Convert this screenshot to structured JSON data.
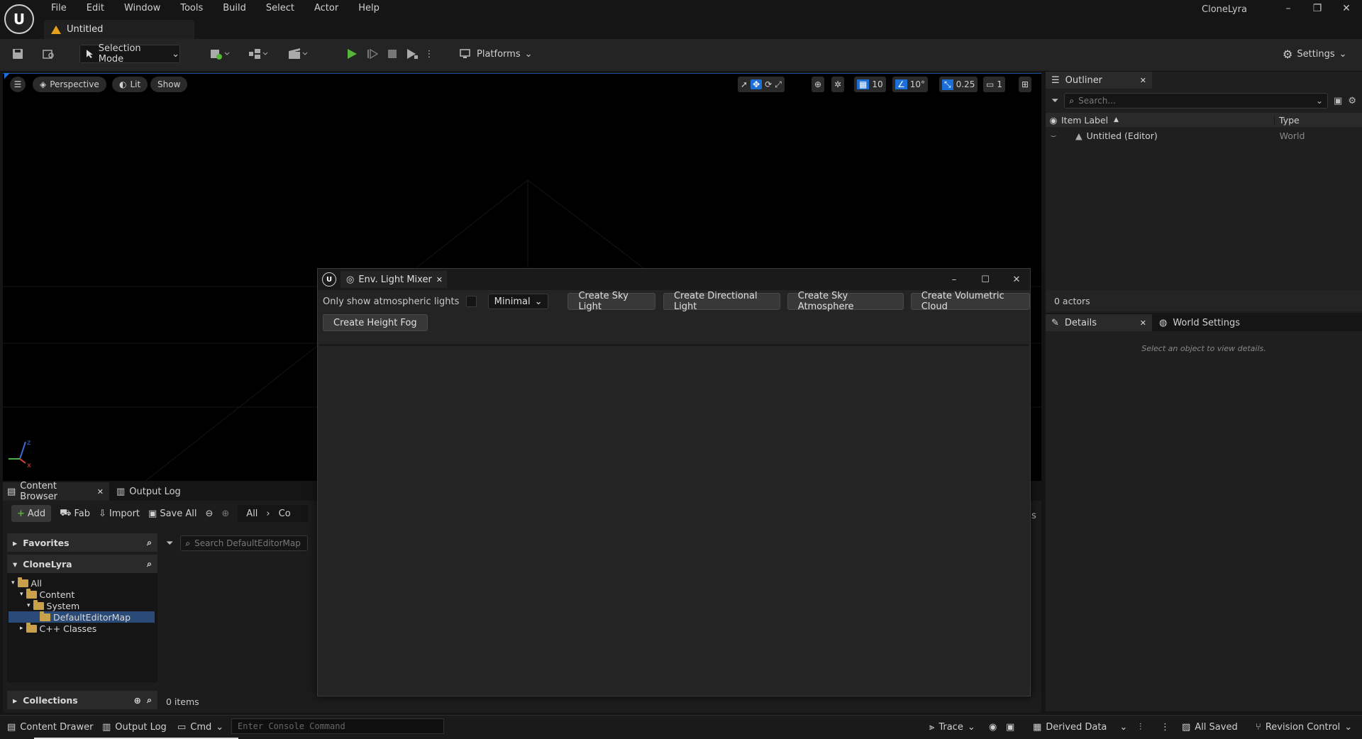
{
  "app": {
    "name": "CloneLyra",
    "doc_tab": "Untitled"
  },
  "menu": [
    "File",
    "Edit",
    "Window",
    "Tools",
    "Build",
    "Select",
    "Actor",
    "Help"
  ],
  "toolbar": {
    "selection_mode": "Selection Mode",
    "platforms": "Platforms",
    "settings": "Settings"
  },
  "viewport": {
    "perspective": "Perspective",
    "lit": "Lit",
    "show": "Show",
    "grid_snap": "10",
    "rotation_snap": "10°",
    "scale_snap": "0.25",
    "camera_speed": "1",
    "axis": {
      "z": "z",
      "x": "x",
      "y": "y"
    }
  },
  "outliner": {
    "tab": "Outliner",
    "search_placeholder": "Search...",
    "col_label": "Item Label",
    "col_type": "Type",
    "items": [
      {
        "label": "Untitled (Editor)",
        "type": "World"
      }
    ],
    "count": "0 actors"
  },
  "details": {
    "tab": "Details",
    "world_settings_tab": "World Settings",
    "empty_msg": "Select an object to view details."
  },
  "content_browser": {
    "tab": "Content Browser",
    "output_log_tab": "Output Log",
    "add": "Add",
    "fab": "Fab",
    "import": "Import",
    "save_all": "Save All",
    "path_all": "All",
    "path_next": "Co",
    "favorites": "Favorites",
    "project": "CloneLyra",
    "tree": {
      "all": "All",
      "content": "Content",
      "system": "System",
      "map": "DefaultEditorMap",
      "cpp": "C++ Classes"
    },
    "collections": "Collections",
    "search_placeholder": "Search DefaultEditorMap",
    "items_count": "0 items",
    "cut_char": "s"
  },
  "mixer": {
    "tab": "Env. Light Mixer",
    "only_show_label": "Only show atmospheric lights",
    "mode": "Minimal",
    "buttons": [
      "Create Sky Light",
      "Create Directional Light",
      "Create Sky Atmosphere",
      "Create Volumetric Cloud"
    ],
    "height_fog": "Create Height Fog"
  },
  "statusbar": {
    "content_drawer": "Content Drawer",
    "output_log": "Output Log",
    "cmd": "Cmd",
    "console_placeholder": "Enter Console Command",
    "trace": "Trace",
    "derived_data": "Derived Data",
    "all_saved": "All Saved",
    "revision_control": "Revision Control"
  },
  "colors": {
    "accent_blue": "#1c6fd6",
    "play_green": "#57b53a",
    "folder": "#c9a14a",
    "warning": "#e3a21a",
    "selection": "#2a4a78"
  }
}
